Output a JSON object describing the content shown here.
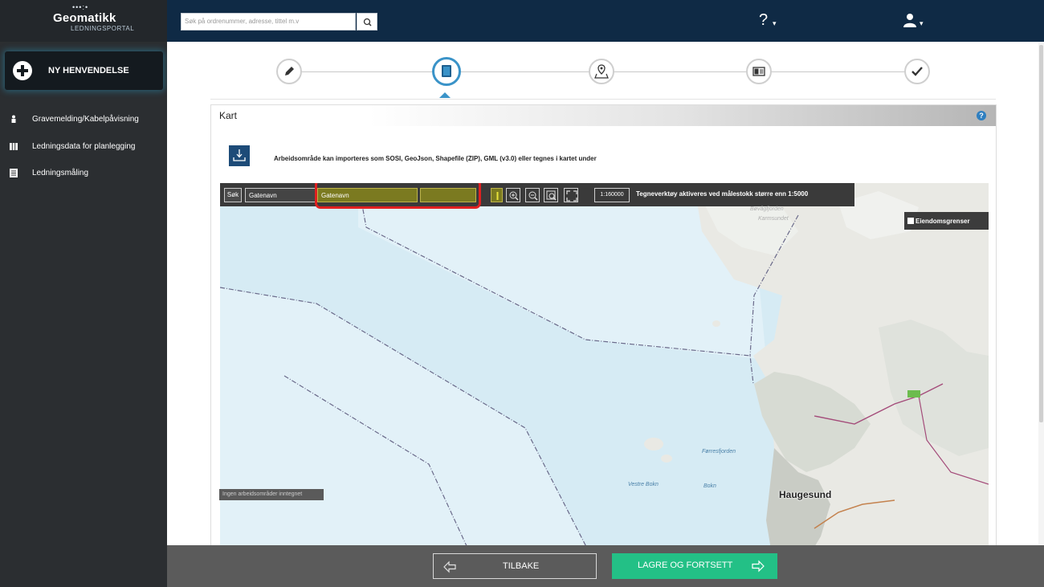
{
  "app": {
    "logo_main": "Geomatikk",
    "logo_sub": "LEDNINGSPORTAL",
    "search_placeholder": "Søk på ordrenummer, adresse, tittel m.v",
    "help_symbol": "?",
    "caret": "▾"
  },
  "sidebar": {
    "new_button_label": "NY HENVENDELSE",
    "items": [
      {
        "label": "Gravemelding/Kabelpåvisning",
        "icon": "person-icon"
      },
      {
        "label": "Ledningsdata for planlegging",
        "icon": "grid-icon"
      },
      {
        "label": "Ledningsmåling",
        "icon": "document-icon"
      }
    ]
  },
  "steps": [
    {
      "icon": "pencil-icon",
      "active": false
    },
    {
      "icon": "map-book-icon",
      "active": true
    },
    {
      "icon": "map-pin-icon",
      "active": false
    },
    {
      "icon": "summary-icon",
      "active": false
    },
    {
      "icon": "checkmark-icon",
      "active": false
    }
  ],
  "panel": {
    "title": "Kart",
    "help_symbol": "?",
    "import_text": "Arbeidsområde kan importeres som SOSI, GeoJson, Shapefile (ZIP), GML (v3.0) eller tegnes i kartet under"
  },
  "map": {
    "search_button": "Søk",
    "search_type": "Gatenavn",
    "street_input_value": "Gatenavn",
    "scale": "1:160000",
    "draw_message": "Tegneverktøy aktiveres ved målestokk større enn 1:5000",
    "property_layer_label": "Eiendomsgrenser",
    "property_layer_checked": true,
    "city_label": "Haugesund",
    "place_labels": [
      "Bøvågfjorden",
      "Karmsundet",
      "Førresfjorden",
      "Bokn",
      "Vestre Bokn"
    ],
    "status_text": "Ingen arbeidsområder inntegnet"
  },
  "actions": {
    "back_label": "TILBAKE",
    "save_label": "LAGRE OG FORTSETT"
  },
  "colors": {
    "topbar": "#0f2a45",
    "sidebar": "#2b2e31",
    "accent": "#3a93c8",
    "save_button": "#23c086",
    "highlight": "#e02020"
  }
}
